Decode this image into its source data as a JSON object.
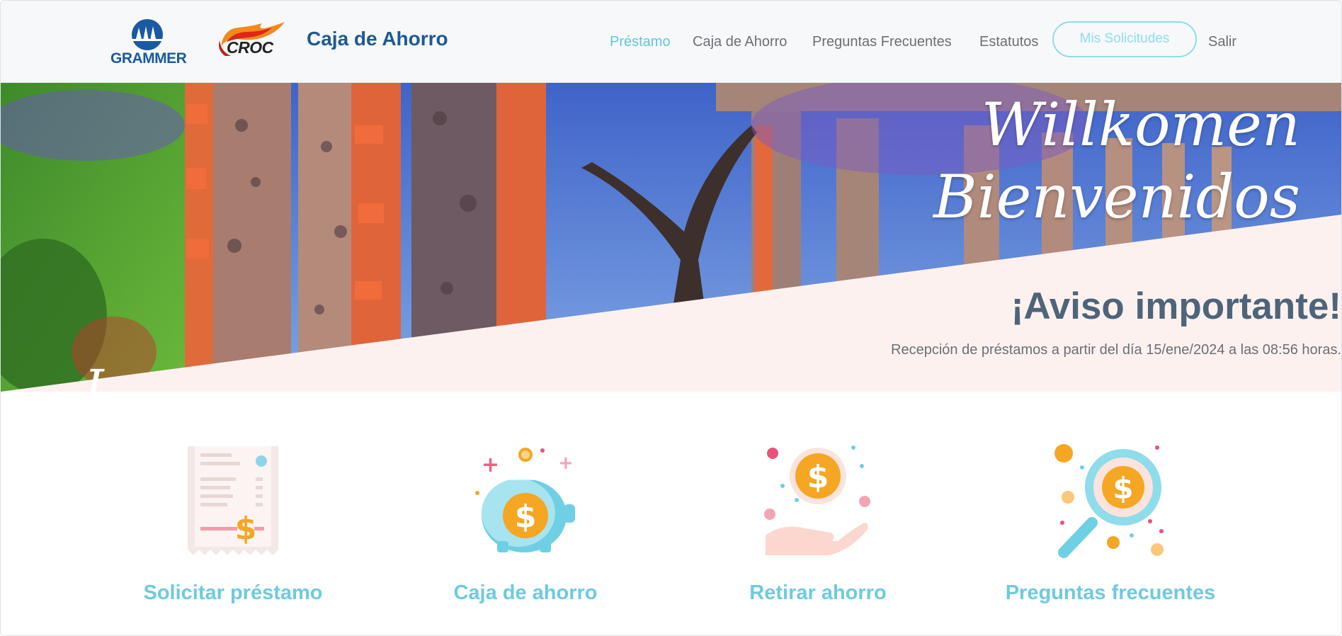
{
  "header": {
    "logos": {
      "grammer": "GRAMMER",
      "croc": "CROC"
    },
    "brand_title": "Caja de Ahorro",
    "nav": [
      {
        "label": "Préstamo",
        "active": true
      },
      {
        "label": "Caja de Ahorro",
        "active": false
      },
      {
        "label": "Preguntas Frecuentes",
        "active": false
      },
      {
        "label": "Estatutos",
        "active": false
      }
    ],
    "requests_button": "Mis Solicitudes",
    "logout": "Salir"
  },
  "hero": {
    "welcome_line1": "Willkomen",
    "welcome_line2": "Bienvenidos",
    "stray_text": "I",
    "notice_title": "¡Aviso importante!",
    "notice_text": "Recepción de préstamos a partir del día 15/ene/2024 a las 08:56 horas."
  },
  "cards": [
    {
      "label": "Solicitar préstamo",
      "icon": "receipt-dollar-icon"
    },
    {
      "label": "Caja de ahorro",
      "icon": "piggy-bank-icon"
    },
    {
      "label": "Retirar ahorro",
      "icon": "hand-coin-icon"
    },
    {
      "label": "Preguntas frecuentes",
      "icon": "magnifier-coin-icon"
    }
  ],
  "colors": {
    "accent": "#5fc7dc",
    "brand_blue": "#1e5a92",
    "notice_panel": "#fdf1f0",
    "notice_title": "#4e6479",
    "coin_orange": "#f5a623"
  }
}
